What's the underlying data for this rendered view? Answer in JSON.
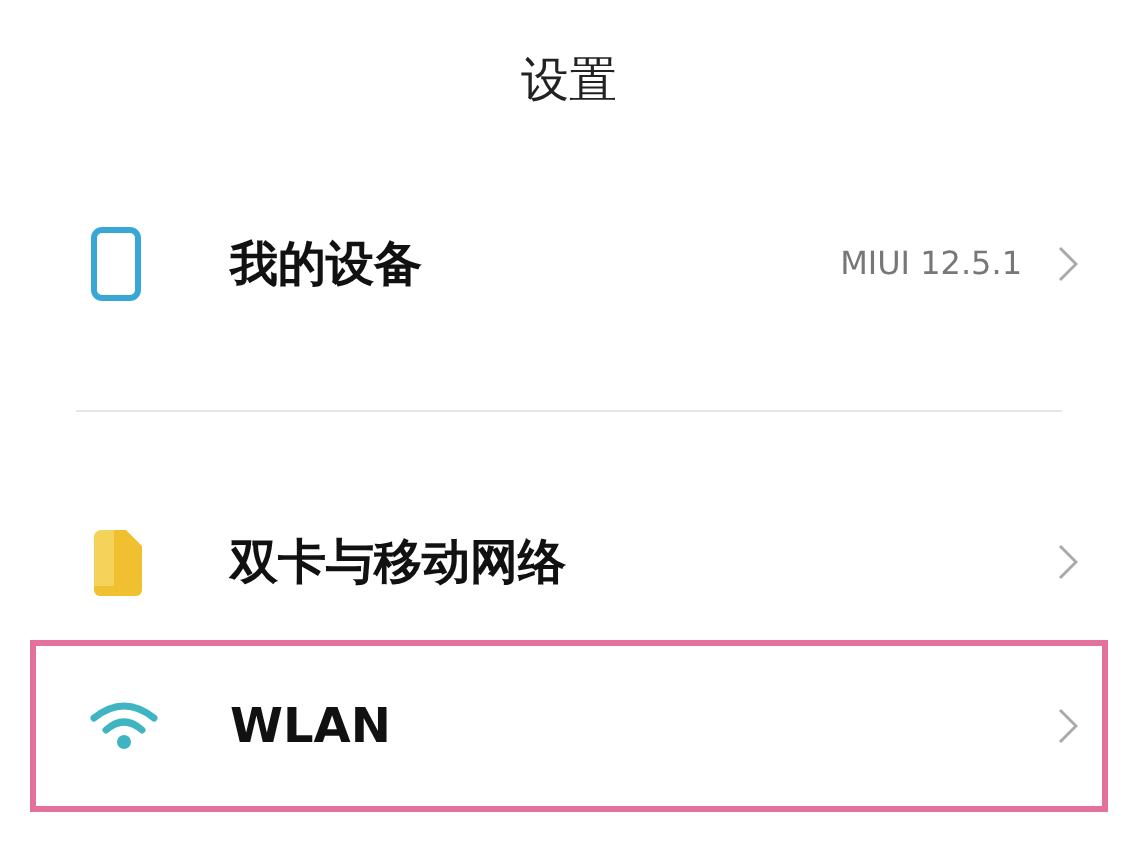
{
  "title": "设置",
  "groups": [
    [
      {
        "kind": "device",
        "label": "我的设备",
        "value": "MIUI 12.5.1",
        "highlighted": false
      }
    ],
    [
      {
        "kind": "sim",
        "label": "双卡与移动网络",
        "highlighted": false
      },
      {
        "kind": "wifi",
        "label": "WLAN",
        "highlighted": true
      }
    ]
  ]
}
